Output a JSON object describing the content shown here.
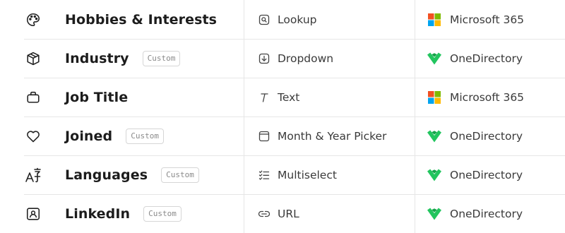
{
  "rows": [
    {
      "name": "Hobbies & Interests",
      "icon": "palette-icon",
      "badge": "",
      "type": "Lookup",
      "type_icon": "lookup-icon",
      "source": "Microsoft 365",
      "source_icon": "microsoft-logo-icon"
    },
    {
      "name": "Industry",
      "icon": "box-icon",
      "badge": "Custom",
      "type": "Dropdown",
      "type_icon": "dropdown-icon",
      "source": "OneDirectory",
      "source_icon": "onedirectory-logo-icon"
    },
    {
      "name": "Job Title",
      "icon": "briefcase-icon",
      "badge": "",
      "type": "Text",
      "type_icon": "text-icon",
      "source": "Microsoft 365",
      "source_icon": "microsoft-logo-icon"
    },
    {
      "name": "Joined",
      "icon": "heart-icon",
      "badge": "Custom",
      "type": "Month & Year Picker",
      "type_icon": "calendar-icon",
      "source": "OneDirectory",
      "source_icon": "onedirectory-logo-icon"
    },
    {
      "name": "Languages",
      "icon": "translate-icon",
      "badge": "Custom",
      "type": "Multiselect",
      "type_icon": "checklist-icon",
      "source": "OneDirectory",
      "source_icon": "onedirectory-logo-icon"
    },
    {
      "name": "LinkedIn",
      "icon": "contact-card-icon",
      "badge": "Custom",
      "type": "URL",
      "type_icon": "link-icon",
      "source": "OneDirectory",
      "source_icon": "onedirectory-logo-icon"
    }
  ],
  "colors": {
    "microsoft_red": "#f25022",
    "microsoft_green": "#7fba00",
    "microsoft_blue": "#00a4ef",
    "microsoft_yellow": "#ffb900",
    "onedirectory_green": "#22c55e"
  }
}
